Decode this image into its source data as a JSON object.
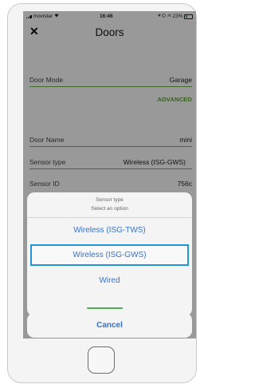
{
  "status_bar": {
    "carrier": "movistar",
    "time": "16:46",
    "battery": "23%"
  },
  "header": {
    "close_icon": "✕",
    "title": "Doors"
  },
  "form": {
    "door_mode": {
      "label": "Door Mode",
      "value": "Garage"
    },
    "advanced_link": "ADVANCED",
    "door_name": {
      "label": "Door Name",
      "value": "mini"
    },
    "sensor_type": {
      "label": "Sensor type",
      "value": "Wireless (ISG-GWS)"
    },
    "sensor_id": {
      "label": "Sensor ID",
      "value": "756c"
    }
  },
  "action_sheet": {
    "title": "Sensor type",
    "subtitle": "Select an option",
    "options": [
      {
        "label": "Wireless (ISG-TWS)"
      },
      {
        "label": "Wireless (ISG-GWS)"
      },
      {
        "label": "Wired"
      }
    ],
    "selected_option": "Wireless (ISG-GWS)",
    "cancel_label": "Cancel"
  },
  "colors": {
    "accent_green": "#5aa12f",
    "ios_blue": "#3772c8",
    "selection_border": "#2196d6"
  }
}
